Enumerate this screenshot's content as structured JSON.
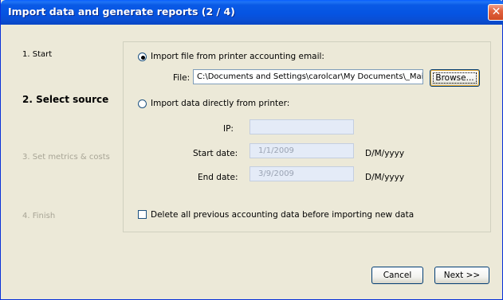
{
  "window": {
    "title": "Import data and generate reports (2 / 4)",
    "close_label": "✕"
  },
  "steps": [
    {
      "label": "1. Start",
      "state": "done"
    },
    {
      "label": "2. Select source",
      "state": "current"
    },
    {
      "label": "3. Set metrics & costs",
      "state": "disabled"
    },
    {
      "label": "4. Finish",
      "state": "disabled"
    }
  ],
  "source": {
    "email_option": {
      "label": "Import file from printer accounting email:",
      "selected": true,
      "file_label": "File:",
      "file_value": "C:\\Documents and Settings\\carolcar\\My Documents\\_Main\\",
      "browse_label": "Browse..."
    },
    "printer_option": {
      "label": "Import data directly from printer:",
      "selected": false,
      "ip_label": "IP:",
      "ip_value": "",
      "start_date_label": "Start date:",
      "start_date_value": "1/1/2009",
      "start_date_format": "D/M/yyyy",
      "end_date_label": "End date:",
      "end_date_value": "3/9/2009",
      "end_date_format": "D/M/yyyy"
    },
    "delete_previous": {
      "label": "Delete all previous accounting data before importing new data",
      "checked": false
    }
  },
  "footer": {
    "cancel_label": "Cancel",
    "next_label": "Next >>"
  },
  "colors": {
    "titlebar": "#0554e2",
    "window_bg": "#ece9d8",
    "disabled_text": "#a8a596",
    "disabled_input_bg": "#e4ebf7"
  }
}
